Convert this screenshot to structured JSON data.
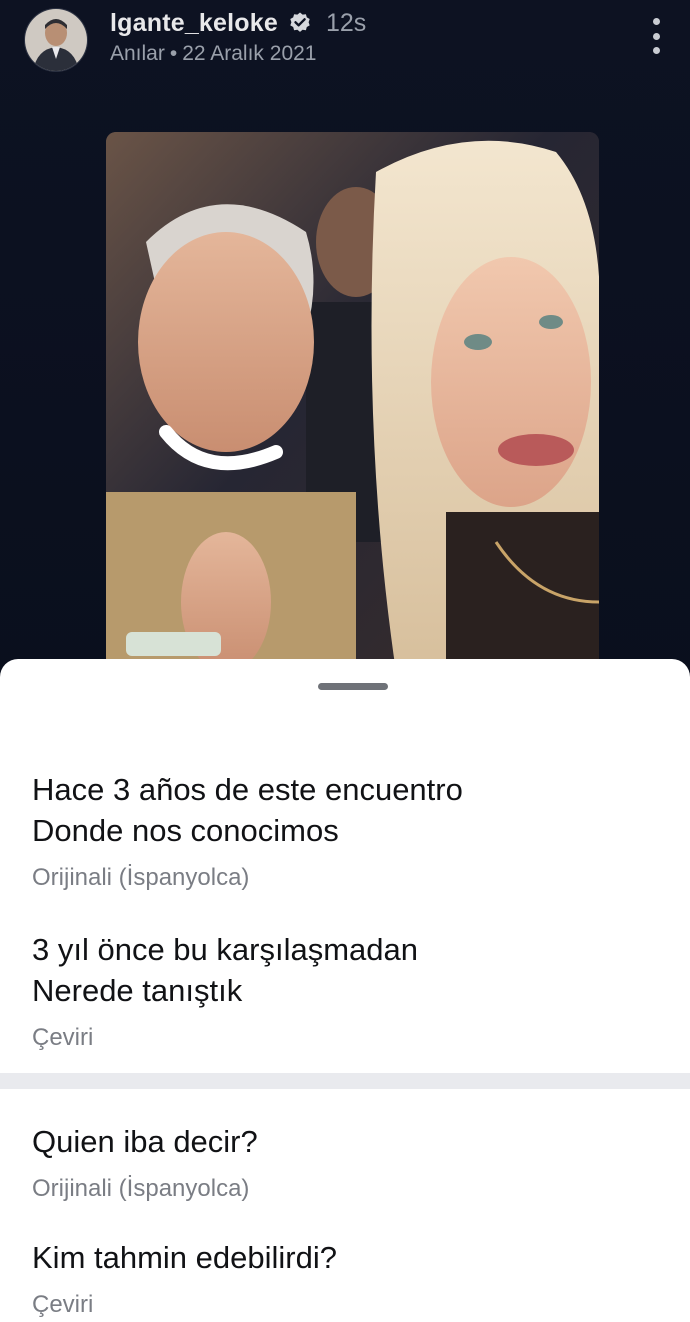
{
  "post": {
    "username": "lgante_keloke",
    "time_ago": "12s",
    "category": "Anılar",
    "separator": "•",
    "date": "22 Aralık 2021"
  },
  "icons": {
    "verified": "verified-badge-icon",
    "more": "more-vertical-icon",
    "drag": "drag-handle"
  },
  "translations": [
    {
      "original_line1": "Hace 3 años de este encuentro",
      "original_line2": "Donde nos conocimos",
      "original_label": "Orijinali (İspanyolca)",
      "translated_line1": "3 yıl önce bu karşılaşmadan",
      "translated_line2": "Nerede tanıştık",
      "translated_label": "Çeviri"
    },
    {
      "original_line1": "Quien iba decir?",
      "original_label": "Orijinali (İspanyolca)",
      "translated_line1": "Kim tahmin edebilirdi?",
      "translated_label": "Çeviri"
    }
  ],
  "colors": {
    "backdrop": "#0b1020",
    "sheet": "#ffffff",
    "primary_text": "#111215",
    "secondary_text": "#7a7d84",
    "divider": "#e9eaee"
  }
}
